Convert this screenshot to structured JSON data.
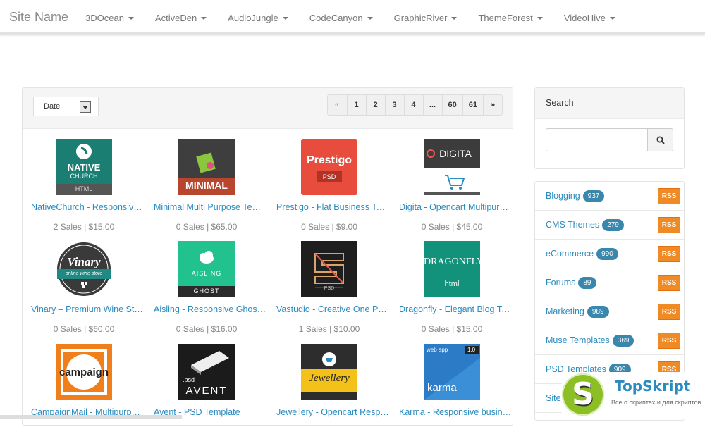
{
  "topbar": {
    "brand": "Site Name",
    "nav": [
      {
        "label": "3DOcean"
      },
      {
        "label": "ActiveDen"
      },
      {
        "label": "AudioJungle"
      },
      {
        "label": "CodeCanyon"
      },
      {
        "label": "GraphicRiver"
      },
      {
        "label": "ThemeForest"
      },
      {
        "label": "VideoHive"
      }
    ]
  },
  "toolbar": {
    "sort_value": "Date",
    "pagination": [
      "«",
      "1",
      "2",
      "3",
      "4",
      "...",
      "60",
      "61",
      "»"
    ]
  },
  "items": [
    {
      "title": "NativeChurch - Responsive Church Template",
      "meta": "2 Sales | $15.00",
      "thumb_text": "NATIVE CHURCH HTML"
    },
    {
      "title": "Minimal Multi Purpose Template",
      "meta": "0 Sales | $65.00",
      "thumb_text": "MINIMAL"
    },
    {
      "title": "Prestigo - Flat Business Template",
      "meta": "0 Sales | $9.00",
      "thumb_text": "Prestigo PSD"
    },
    {
      "title": "Digita - Opencart Multipurpose Theme",
      "meta": "0 Sales | $45.00",
      "thumb_text": "DIGITA"
    },
    {
      "title": "Vinary – Premium Wine Store Theme",
      "meta": "0 Sales | $60.00",
      "thumb_text": "Vinary online wine store"
    },
    {
      "title": "Aisling - Responsive Ghost Theme",
      "meta": "0 Sales | $16.00",
      "thumb_text": "AISLING GHOST"
    },
    {
      "title": "Vastudio - Creative One Page PSD",
      "meta": "1 Sales | $10.00",
      "thumb_text": "PSD"
    },
    {
      "title": "Dragonfly - Elegant Blog Template",
      "meta": "0 Sales | $15.00",
      "thumb_text": "DRAGONFLY html"
    },
    {
      "title": "CampaignMail - Multipurpose Email",
      "meta": "",
      "thumb_text": "campaign"
    },
    {
      "title": "Avent - PSD Template",
      "meta": "",
      "thumb_text": ".psd AVENT"
    },
    {
      "title": "Jewellery - Opencart Responsive Theme",
      "meta": "",
      "thumb_text": "Jewellery"
    },
    {
      "title": "Karma - Responsive business template",
      "meta": "",
      "thumb_text": "web app 1.0 karma"
    }
  ],
  "search": {
    "title": "Search",
    "placeholder": ""
  },
  "categories": [
    {
      "name": "Blogging",
      "count": "937",
      "rss": "RSS"
    },
    {
      "name": "CMS Themes",
      "count": "279",
      "rss": "RSS"
    },
    {
      "name": "eCommerce",
      "count": "990",
      "rss": "RSS"
    },
    {
      "name": "Forums",
      "count": "89",
      "rss": "RSS"
    },
    {
      "name": "Marketing",
      "count": "989",
      "rss": "RSS"
    },
    {
      "name": "Muse Templates",
      "count": "369",
      "rss": "RSS"
    },
    {
      "name": "PSD Templates",
      "count": "909",
      "rss": "RSS"
    },
    {
      "name": "Site",
      "count": "",
      "rss": ""
    }
  ],
  "watermark": {
    "name": "TopSkript",
    "tagline": "Все о скриптах и для скриптов..."
  },
  "colors": {
    "link": "#2a8bc0",
    "badge": "#3a87ad",
    "rss": "#f08a24"
  }
}
